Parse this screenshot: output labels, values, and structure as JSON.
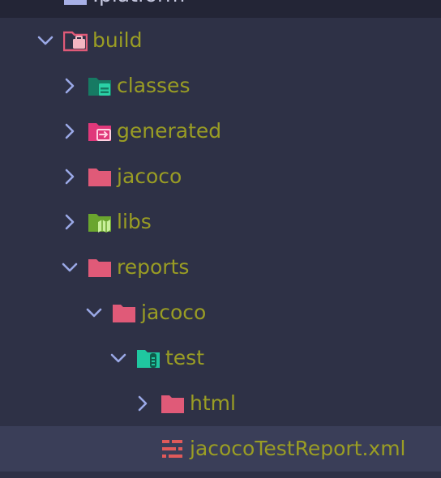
{
  "tree": {
    "items": [
      {
        "label": ".platform",
        "expanded": true,
        "icon": "folder-icon"
      },
      {
        "label": "build",
        "expanded": true,
        "icon": "folder-open-build-icon"
      },
      {
        "label": "classes",
        "expanded": false,
        "icon": "folder-classes-icon"
      },
      {
        "label": "generated",
        "expanded": false,
        "icon": "folder-generated-icon"
      },
      {
        "label": "jacoco",
        "expanded": false,
        "icon": "folder-icon"
      },
      {
        "label": "libs",
        "expanded": false,
        "icon": "folder-libs-icon"
      },
      {
        "label": "reports",
        "expanded": true,
        "icon": "folder-icon"
      },
      {
        "label": "jacoco",
        "expanded": true,
        "icon": "folder-icon"
      },
      {
        "label": "test",
        "expanded": true,
        "icon": "folder-test-icon"
      },
      {
        "label": "html",
        "expanded": false,
        "icon": "folder-icon"
      },
      {
        "label": "jacocoTestReport.xml",
        "selected": true,
        "icon": "xml-file-icon"
      }
    ]
  },
  "colors": {
    "background": "#2e3146",
    "selected_row": "#3a3e58",
    "label": "#9a9d24",
    "chevron": "#9aa8e6",
    "folder_pink": "#e05a78",
    "folder_teal": "#1fa98a",
    "folder_green": "#7bbd3a",
    "xml_red": "#e05a5a"
  }
}
